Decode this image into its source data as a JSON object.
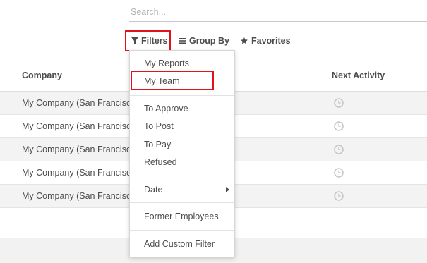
{
  "search": {
    "placeholder": "Search..."
  },
  "toolbar": {
    "filters_label": "Filters",
    "group_by_label": "Group By",
    "favorites_label": "Favorites"
  },
  "table": {
    "columns": {
      "company": "Company",
      "next_activity": "Next Activity"
    },
    "rows": [
      {
        "company": "My Company (San Francisco)"
      },
      {
        "company": "My Company (San Francisco)"
      },
      {
        "company": "My Company (San Francisco)"
      },
      {
        "company": "My Company (San Francisco)"
      },
      {
        "company": "My Company (San Francisco)"
      }
    ]
  },
  "filters_menu": {
    "my_reports": "My Reports",
    "my_team": "My Team",
    "to_approve": "To Approve",
    "to_post": "To Post",
    "to_pay": "To Pay",
    "refused": "Refused",
    "date": "Date",
    "former_employees": "Former Employees",
    "add_custom_filter": "Add Custom Filter"
  },
  "colors": {
    "highlight": "#e0121b",
    "text": "#4c4c4c",
    "icon_muted": "#c6c6c6"
  }
}
